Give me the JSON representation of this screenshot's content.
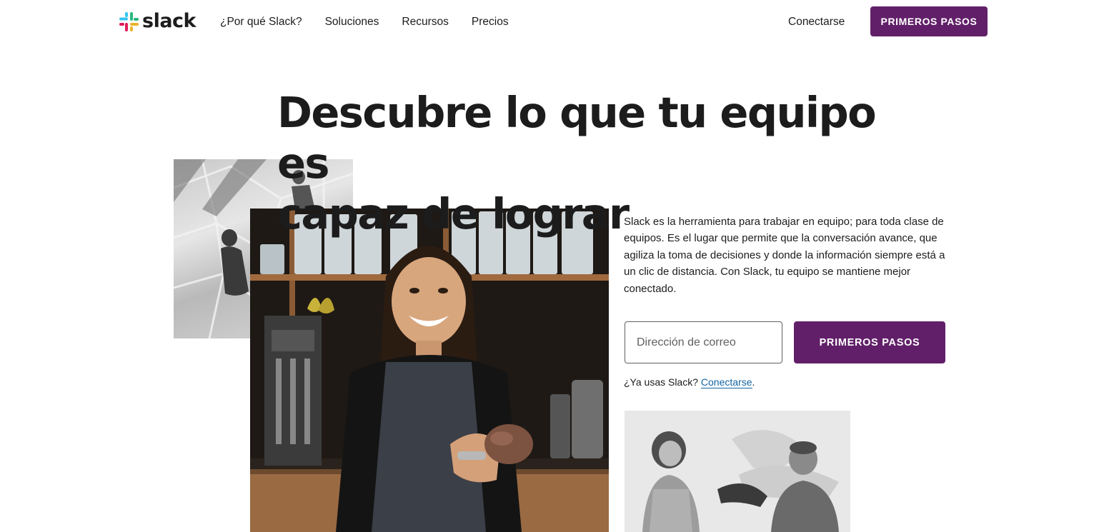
{
  "header": {
    "logo_text": "slack",
    "nav": [
      "¿Por qué Slack?",
      "Soluciones",
      "Recursos",
      "Precios"
    ],
    "signin_label": "Conectarse",
    "cta_label": "PRIMEROS PASOS"
  },
  "hero": {
    "headline_line1": "Descubre lo que tu equipo es",
    "headline_line2": "capaz de lograr",
    "description": "Slack es la herramienta para trabajar en equipo; para toda clase de equipos. Es el lugar que permite que la conversación avance, que agiliza la toma de decisiones y donde la información siempre está a un clic de distancia. Con Slack, tu equipo se mantiene mejor conectado.",
    "email_placeholder": "Dirección de correo",
    "cta_label": "PRIMEROS PASOS",
    "already_prefix": "¿Ya usas Slack? ",
    "already_link": "Conectarse",
    "already_suffix": "."
  },
  "colors": {
    "brand_purple": "#611f69",
    "link_blue": "#1264a3",
    "text": "#1d1c1d"
  },
  "icons": {
    "logo": "slack-hash-icon"
  }
}
